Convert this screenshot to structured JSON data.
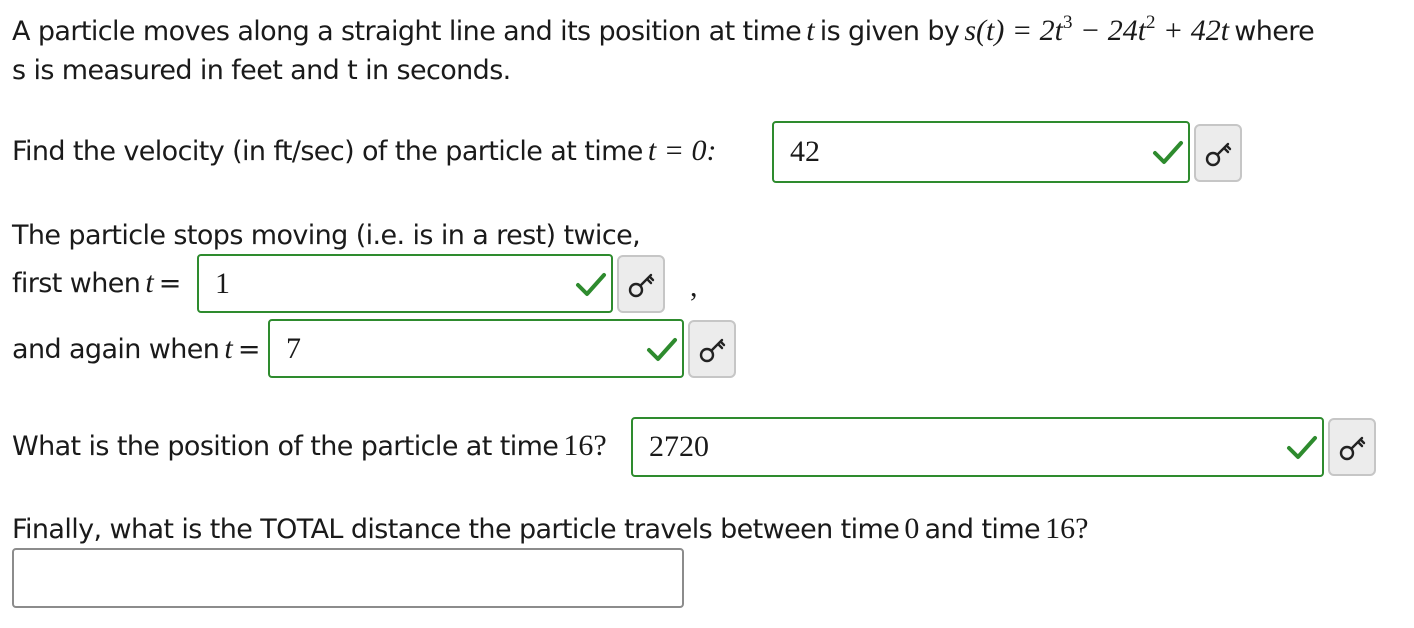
{
  "question": {
    "intro_prefix": "A particle moves along a straight line and its position at time",
    "intro_var": "t",
    "intro_middle": "is given by",
    "formula_lhs": "s(t) = 2t",
    "formula_exp1": "3",
    "formula_mid": " − 24t",
    "formula_exp2": "2",
    "formula_tail": " + 42t",
    "intro_suffix": "where",
    "intro_line2": "s is measured in feet and t in seconds."
  },
  "part1": {
    "label": "Find the velocity (in ft/sec) of the particle at time",
    "label_math": "t = 0:",
    "answer": "42",
    "status": "correct"
  },
  "part2": {
    "intro": "The particle stops moving (i.e. is in a rest) twice,",
    "first_label": "first when",
    "first_var": "t",
    "first_eq": "=",
    "first_answer": "1",
    "separator": ",",
    "second_label": "and again when",
    "second_var": "t",
    "second_eq": "=",
    "second_answer": "7"
  },
  "part3": {
    "label": "What is the position of the particle at time",
    "label_math": "16?",
    "answer": "2720"
  },
  "part4": {
    "label_a": "Finally, what is the TOTAL distance the particle travels between time",
    "label_math_a": "0",
    "label_b": "and time",
    "label_math_b": "16?",
    "answer": ""
  },
  "icons": {
    "correct": "check-icon",
    "answer_key": "key-icon"
  },
  "colors": {
    "correct_border": "#2e8b2e",
    "check_mark": "#2e8b2e",
    "empty_border": "#8c8c8c",
    "key_button_bg": "#ececec"
  }
}
